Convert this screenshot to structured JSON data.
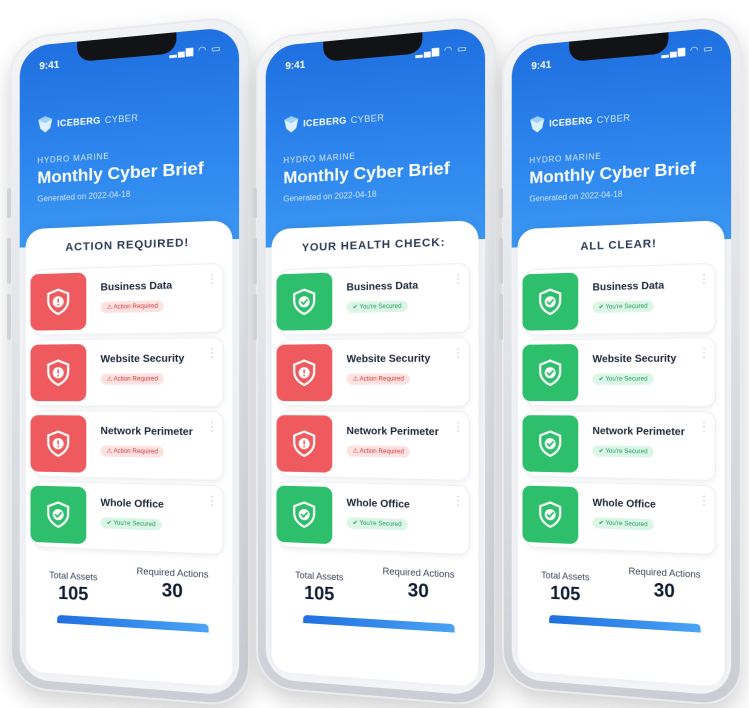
{
  "phones": [
    {
      "time": "9:41",
      "status_icons": "signal-wifi-battery",
      "brand_name": "ICEBERG",
      "brand_sub": "CYBER",
      "company": "HYDRO MARINE",
      "title": "Monthly Cyber Brief",
      "generated": "Generated on 2022-04-18",
      "headline": "ACTION REQUIRED!",
      "assets": [
        {
          "name": "Business Data",
          "status": "Action Required",
          "state": "danger"
        },
        {
          "name": "Website Security",
          "status": "Action Required",
          "state": "danger"
        },
        {
          "name": "Network Perimeter",
          "status": "Action Required",
          "state": "danger"
        },
        {
          "name": "Whole Office",
          "status": "You're Secured",
          "state": "ok"
        }
      ],
      "total_assets_label": "Total Assets",
      "total_assets_value": "105",
      "required_actions_label": "Required Actions",
      "required_actions_value": "30"
    },
    {
      "time": "9:41",
      "status_icons": "signal-wifi-battery",
      "brand_name": "ICEBERG",
      "brand_sub": "CYBER",
      "company": "HYDRO MARINE",
      "title": "Monthly Cyber Brief",
      "generated": "Generated on 2022-04-18",
      "headline": "YOUR HEALTH CHECK:",
      "assets": [
        {
          "name": "Business Data",
          "status": "You're Secured",
          "state": "ok"
        },
        {
          "name": "Website Security",
          "status": "Action Required",
          "state": "danger"
        },
        {
          "name": "Network Perimeter",
          "status": "Action Required",
          "state": "danger"
        },
        {
          "name": "Whole Office",
          "status": "You're Secured",
          "state": "ok"
        }
      ],
      "total_assets_label": "Total Assets",
      "total_assets_value": "105",
      "required_actions_label": "Required Actions",
      "required_actions_value": "30"
    },
    {
      "time": "9:41",
      "status_icons": "signal-wifi-battery",
      "brand_name": "ICEBERG",
      "brand_sub": "CYBER",
      "company": "HYDRO MARINE",
      "title": "Monthly Cyber Brief",
      "generated": "Generated on 2022-04-18",
      "headline": "ALL CLEAR!",
      "assets": [
        {
          "name": "Business Data",
          "status": "You're Secured",
          "state": "ok"
        },
        {
          "name": "Website Security",
          "status": "You're Secured",
          "state": "ok"
        },
        {
          "name": "Network Perimeter",
          "status": "You're Secured",
          "state": "ok"
        },
        {
          "name": "Whole Office",
          "status": "You're Secured",
          "state": "ok"
        }
      ],
      "total_assets_label": "Total Assets",
      "total_assets_value": "105",
      "required_actions_label": "Required Actions",
      "required_actions_value": "30"
    }
  ],
  "colors": {
    "danger": "#ee5a5d",
    "ok": "#2dbf6b",
    "hero": "#2f89ef"
  }
}
